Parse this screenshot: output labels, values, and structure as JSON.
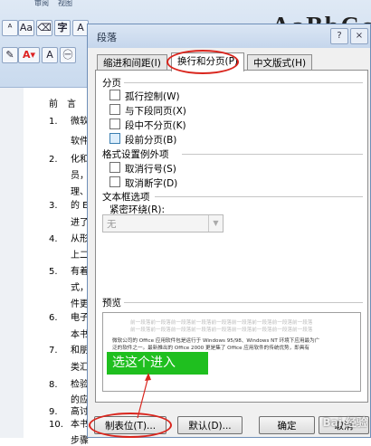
{
  "ribbon": {
    "tabs": [
      "审阅",
      "视图"
    ],
    "big_sample": "AaBbCc"
  },
  "document": {
    "heading": "前　言",
    "lines": [
      {
        "num": "1.",
        "text": "微软"
      },
      {
        "num": "",
        "text": "软件"
      },
      {
        "num": "2.",
        "text": "化和"
      },
      {
        "num": "",
        "text": "员，"
      },
      {
        "num": "",
        "text": "理、"
      },
      {
        "num": "3.",
        "text": "的 E"
      },
      {
        "num": "",
        "text": "进了"
      },
      {
        "num": "4.",
        "text": "从形"
      },
      {
        "num": "",
        "text": "上二"
      },
      {
        "num": "5.",
        "text": "有着"
      },
      {
        "num": "",
        "text": "式，"
      },
      {
        "num": "",
        "text": "件更"
      },
      {
        "num": "6.",
        "text": "电子"
      },
      {
        "num": "",
        "text": "本书"
      },
      {
        "num": "7.",
        "text": "和朋"
      },
      {
        "num": "",
        "text": "类汇"
      },
      {
        "num": "8.",
        "text": "检验"
      },
      {
        "num": "",
        "text": "的应"
      },
      {
        "num": "9.",
        "text": "高讨"
      },
      {
        "num": "10.",
        "text": "本书"
      },
      {
        "num": "",
        "text": "步骤"
      }
    ]
  },
  "dialog": {
    "title": "段落",
    "help": "?",
    "close": "×",
    "tabs": [
      "缩进和间距(I)",
      "换行和分页(P)",
      "中文版式(H)"
    ],
    "active_tab": 1,
    "pagination_label": "分页",
    "pagination_options": [
      {
        "label": "孤行控制(W)",
        "checked": false
      },
      {
        "label": "与下段同页(X)",
        "checked": false
      },
      {
        "label": "段中不分页(K)",
        "checked": false
      },
      {
        "label": "段前分页(B)",
        "checked": false
      }
    ],
    "exceptions_label": "格式设置例外项",
    "exceptions_options": [
      {
        "label": "取消行号(S)",
        "checked": false
      },
      {
        "label": "取消断字(D)",
        "checked": false
      }
    ],
    "textbox_label": "文本框选项",
    "tight_wrap_label": "紧密环绕(R):",
    "tight_wrap_value": "无",
    "preview_label": "预览",
    "preview_text": [
      "前一段落前一段落前一段落前一段落前一段落前一段落前一段落前一段落前一段落",
      "前一段落前一段落前一段落前一段落前一段落前一段落前一段落前一段落前一段落",
      "微软公司的 Office 应用软件包是运行于 Windows 95/98、Windows NT 环境下应用最为广",
      "泛的软件之一。最新推出的 Office 2000 更是集了 Office 应用软件的传统优势，即具有"
    ],
    "buttons": {
      "tabs": "制表位(T)...",
      "default": "默认(D)...",
      "ok": "确定",
      "cancel": "取消"
    }
  },
  "annotation": {
    "callout_text": "选这个进入",
    "callout_color": "#1fbf1f",
    "ellipse_color": "#d9251d"
  },
  "watermark": "Bai 经验"
}
